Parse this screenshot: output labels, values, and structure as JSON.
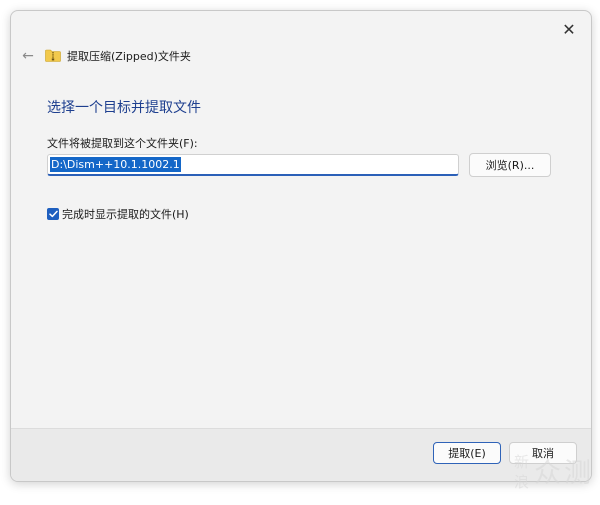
{
  "window": {
    "title": "提取压缩(Zipped)文件夹",
    "close_glyph": "✕",
    "back_glyph": "←"
  },
  "main": {
    "heading": "选择一个目标并提取文件",
    "folder_label": "文件将被提取到这个文件夹(F):",
    "path_value": "D:\\Dism++10.1.1002.1",
    "browse_label": "浏览(R)...",
    "show_files_label": "完成时显示提取的文件(H)",
    "show_files_checked": true
  },
  "footer": {
    "extract_label": "提取(E)",
    "cancel_label": "取消"
  },
  "watermark": {
    "text": "新浪众测"
  },
  "colors": {
    "accent": "#1e5fbf",
    "heading": "#1e3f8f",
    "selection": "#1467c8",
    "folder_yellow": "#f2c94c"
  },
  "icons": {
    "close": "close-icon",
    "back": "back-arrow-icon",
    "folder": "zip-folder-icon",
    "check": "checkmark-icon"
  }
}
